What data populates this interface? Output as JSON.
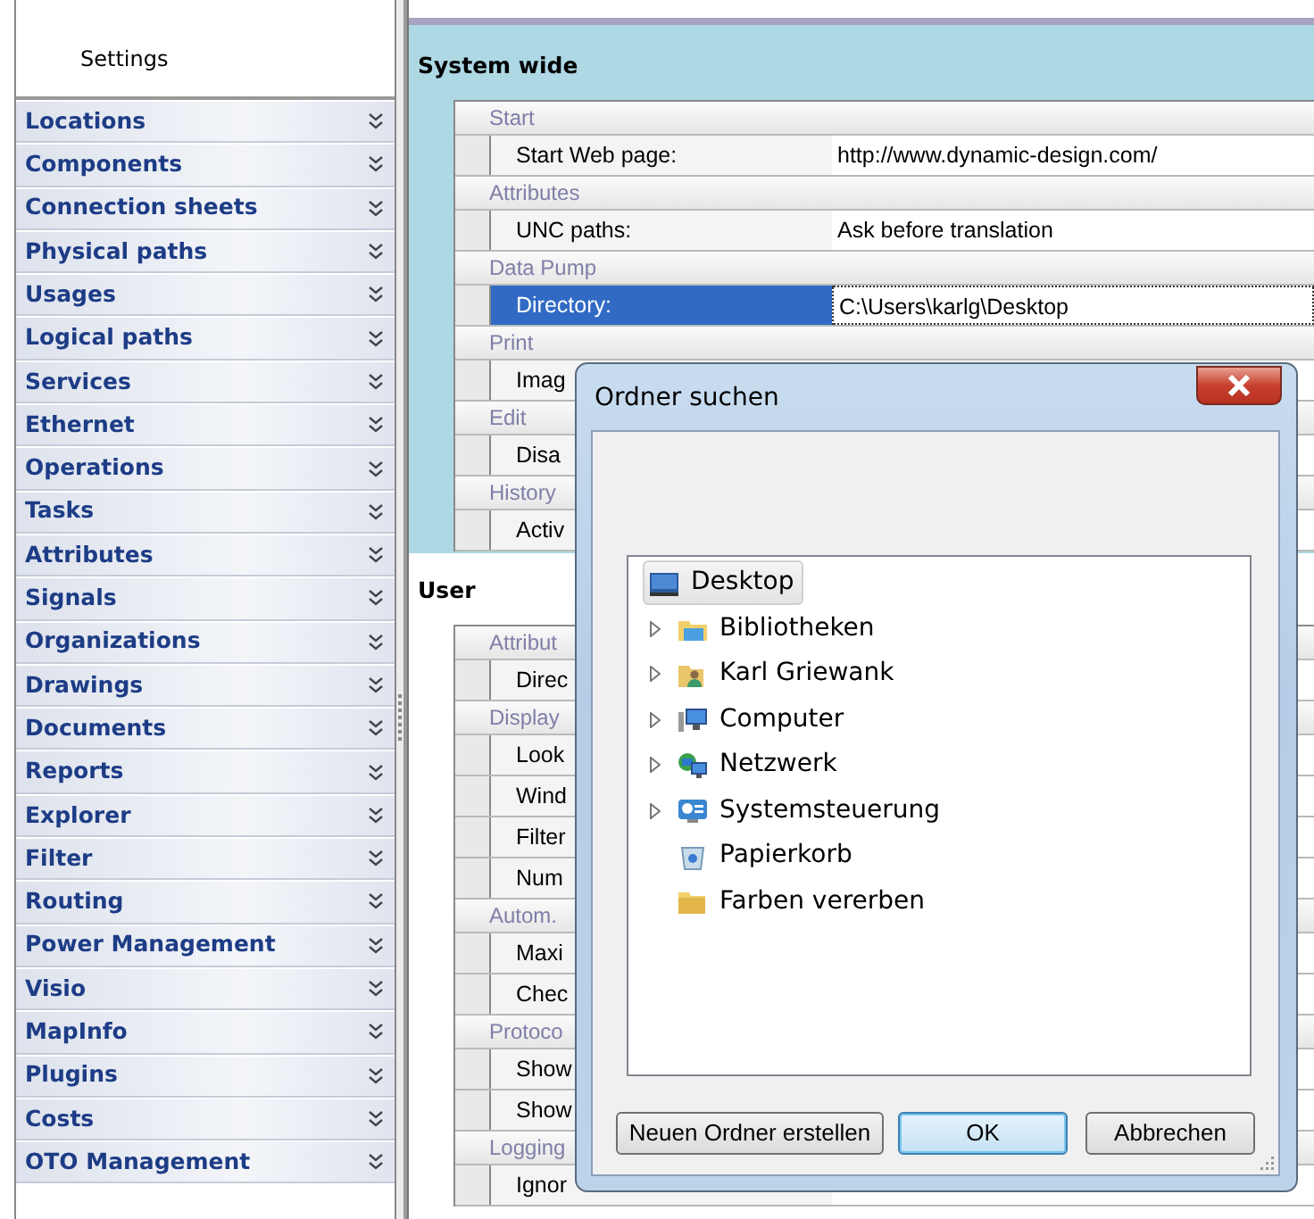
{
  "sidebar": {
    "title": "Settings",
    "items": [
      {
        "label": "Locations"
      },
      {
        "label": "Components"
      },
      {
        "label": "Connection sheets"
      },
      {
        "label": "Physical paths"
      },
      {
        "label": "Usages"
      },
      {
        "label": "Logical paths"
      },
      {
        "label": "Services"
      },
      {
        "label": "Ethernet"
      },
      {
        "label": "Operations"
      },
      {
        "label": "Tasks"
      },
      {
        "label": "Attributes"
      },
      {
        "label": "Signals"
      },
      {
        "label": "Organizations"
      },
      {
        "label": "Drawings"
      },
      {
        "label": "Documents"
      },
      {
        "label": "Reports"
      },
      {
        "label": "Explorer"
      },
      {
        "label": "Filter"
      },
      {
        "label": "Routing"
      },
      {
        "label": "Power Management"
      },
      {
        "label": "Visio"
      },
      {
        "label": "MapInfo"
      },
      {
        "label": "Plugins"
      },
      {
        "label": "Costs"
      },
      {
        "label": "OTO Management"
      }
    ]
  },
  "sections": [
    {
      "title": "System wide",
      "kind": "tinted",
      "groups": [
        {
          "category": "Start",
          "properties": [
            {
              "label": "Start Web page:",
              "value": "http://www.dynamic-design.com/",
              "selected": false
            }
          ]
        },
        {
          "category": "Attributes",
          "properties": [
            {
              "label": "UNC paths:",
              "value": "Ask before translation",
              "selected": false
            }
          ]
        },
        {
          "category": "Data Pump",
          "properties": [
            {
              "label": "Directory:",
              "value": "C:\\Users\\karlg\\Desktop",
              "selected": true
            }
          ]
        },
        {
          "category": "Print",
          "properties": [
            {
              "label": "Imag",
              "selected": false
            }
          ]
        },
        {
          "category": "Edit",
          "properties": [
            {
              "label": "Disa",
              "selected": false
            }
          ]
        },
        {
          "category": "History",
          "properties": [
            {
              "label": "Activ",
              "selected": false
            }
          ]
        }
      ]
    },
    {
      "title": "User",
      "kind": "plain",
      "groups": [
        {
          "category": "Attribut",
          "properties": [
            {
              "label": "Direc",
              "selected": false
            }
          ]
        },
        {
          "category": "Display",
          "properties": [
            {
              "label": "Look",
              "selected": false
            },
            {
              "label": "Wind",
              "selected": false
            },
            {
              "label": "Filter",
              "selected": false
            },
            {
              "label": "Num",
              "selected": false
            }
          ]
        },
        {
          "category": "Autom.",
          "properties": [
            {
              "label": "Maxi",
              "selected": false
            },
            {
              "label": "Chec",
              "selected": false
            }
          ]
        },
        {
          "category": "Protoco",
          "properties": [
            {
              "label": "Show",
              "selected": false
            },
            {
              "label": "Show",
              "selected": false
            }
          ]
        },
        {
          "category": "Logging",
          "properties": [
            {
              "label": "Ignor",
              "selected": false
            }
          ]
        }
      ]
    }
  ],
  "dialog": {
    "title": "Ordner suchen",
    "tree": [
      {
        "label": "Desktop",
        "kind": "desktop",
        "selected": true,
        "children": [
          {
            "label": "Bibliotheken",
            "kind": "library",
            "expandable": true,
            "selected": false
          },
          {
            "label": "Karl Griewank",
            "kind": "user",
            "expandable": true,
            "selected": false
          },
          {
            "label": "Computer",
            "kind": "computer",
            "expandable": true,
            "selected": false
          },
          {
            "label": "Netzwerk",
            "kind": "network",
            "expandable": true,
            "selected": false
          },
          {
            "label": "Systemsteuerung",
            "kind": "control-panel",
            "expandable": true,
            "selected": false
          },
          {
            "label": "Papierkorb",
            "kind": "recycle-bin",
            "expandable": false,
            "selected": false
          },
          {
            "label": "Farben vererben",
            "kind": "folder",
            "expandable": false,
            "selected": false
          }
        ]
      }
    ],
    "buttons": [
      {
        "label": "Neuen Ordner erstellen",
        "default": false
      },
      {
        "label": "OK",
        "default": true
      },
      {
        "label": "Abbrechen",
        "default": false
      }
    ]
  }
}
